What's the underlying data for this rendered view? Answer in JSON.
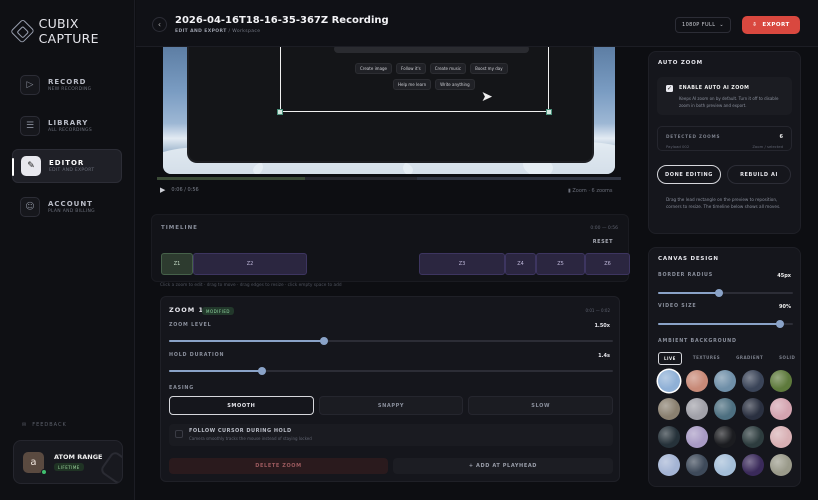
{
  "app": {
    "name": "CUBIX CAPTURE"
  },
  "sidebar": {
    "items": [
      {
        "label": "RECORD",
        "sub": "NEW RECORDING",
        "icon": "video-icon"
      },
      {
        "label": "LIBRARY",
        "sub": "ALL RECORDINGS",
        "icon": "database-icon"
      },
      {
        "label": "EDITOR",
        "sub": "EDIT AND EXPORT",
        "icon": "edit-icon"
      },
      {
        "label": "ACCOUNT",
        "sub": "PLAN AND BILLING",
        "icon": "user-icon"
      }
    ],
    "feedback": "FEEDBACK",
    "user": {
      "initial": "a",
      "name": "ATOM RANGE",
      "plan": "LIFETIME"
    }
  },
  "header": {
    "title": "2026-04-16T18-16-35-367Z Recording",
    "breadcrumb_main": "EDIT AND EXPORT",
    "breadcrumb_sub": "Workspace",
    "quality": "1080P FULL",
    "export_label": "EXPORT"
  },
  "preview": {
    "chips_row1": [
      "Create image",
      "Follow it's",
      "Create music",
      "Boost my day"
    ],
    "chips_row2": [
      "Help me learn",
      "Write anything"
    ]
  },
  "player": {
    "time": "0:06 / 0:56",
    "zoom_info": "6 zooms",
    "zoom_info_label": "Zoom"
  },
  "timeline": {
    "title": "TIMELINE",
    "range": "0:00 — 0:56",
    "reset": "RESET",
    "segments": [
      "Z1",
      "Z2",
      "Z3",
      "Z4",
      "Z5",
      "Z6"
    ],
    "hint": "Click a zoom to edit · drag to move · drag edges to resize · click empty space to add"
  },
  "zoom": {
    "title": "ZOOM 1",
    "badge": "MODIFIED",
    "range": "0:01 — 0:02",
    "level_label": "ZOOM LEVEL",
    "level_value": "1.50x",
    "level": 0.35,
    "hold_label": "HOLD DURATION",
    "hold_value": "1.4s",
    "hold": 0.21,
    "easing_label": "EASING",
    "easing_options": [
      "SMOOTH",
      "SNAPPY",
      "SLOW"
    ],
    "follow_title": "FOLLOW CURSOR DURING HOLD",
    "follow_sub": "Camera smoothly tracks the mouse instead of staying locked",
    "delete_label": "DELETE ZOOM",
    "add_label": "+ ADD AT PLAYHEAD"
  },
  "auto_zoom": {
    "title": "AUTO ZOOM",
    "enable_title": "ENABLE AUTO AI ZOOM",
    "enable_desc": "Keeps AI zoom on by default. Turn it off to disable zoom in both preview and export.",
    "detected_label": "DETECTED ZOOMS",
    "detected_count": "6",
    "detected_sub": "Payload 002",
    "detected_right": "Zoom / selected",
    "done_label": "DONE EDITING",
    "rebuild_label": "REBUILD AI",
    "note": "Drag the lead rectangle on the preview to reposition, corners to resize. The timeline below shows all moves."
  },
  "canvas": {
    "title": "CANVAS DESIGN",
    "radius_label": "BORDER RADIUS",
    "radius_value": "45px",
    "radius": 0.45,
    "size_label": "VIDEO SIZE",
    "size_value": "90%",
    "size": 0.9,
    "ambient_label": "AMBIENT BACKGROUND",
    "tabs": [
      "LIVE",
      "TEXTURES",
      "GRADIENT",
      "SOLID"
    ],
    "swatch_colors": [
      "#8fb0d6",
      "#c88a78",
      "#6f8fa8",
      "#3a4458",
      "#5e7a3c",
      "#8a8070",
      "#a0a0a8",
      "#4d6f80",
      "#2a3040",
      "#d4a4b0",
      "#26323a",
      "#a89ac4",
      "#1b1c20",
      "#2d3c3e",
      "#d8b0b4",
      "#a4b4d4",
      "#3e4a5a",
      "#a4bed8",
      "#3a2a5a",
      "#9a9a8a"
    ]
  }
}
